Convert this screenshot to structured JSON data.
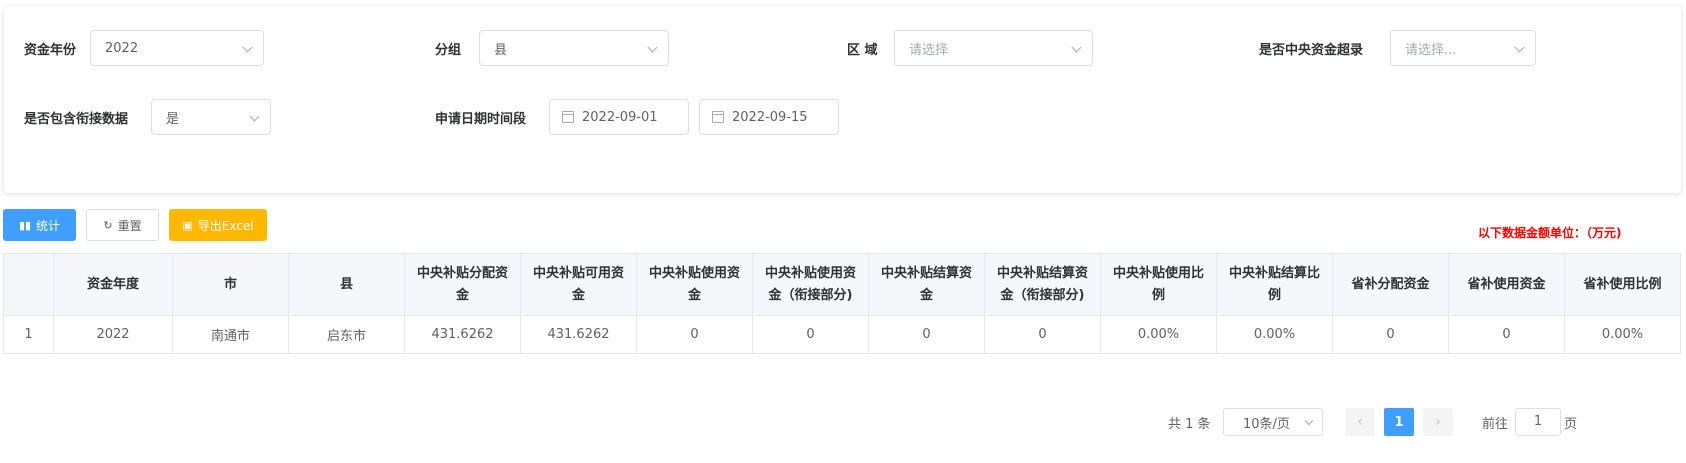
{
  "filters": {
    "fund_year": {
      "label": "资金年份",
      "value": "2022"
    },
    "group": {
      "label": "分组",
      "value": "县"
    },
    "region": {
      "label": "区 域",
      "placeholder": "请选择"
    },
    "central_over_record": {
      "label": "是否中央资金超录",
      "placeholder": "请选择..."
    },
    "include_link_data": {
      "label": "是否包含衔接数据",
      "value": "是"
    },
    "date_range": {
      "label": "申请日期时间段",
      "start": "2022-09-01",
      "end": "2022-09-15"
    }
  },
  "toolbar": {
    "stats_label": "统计",
    "reset_label": "重置",
    "export_label": "导出Excel",
    "unit_note": "以下数据金额单位：（万元)"
  },
  "table": {
    "headers": [
      "",
      "资金年度",
      "市",
      "县",
      "中央补贴分配资金",
      "中央补贴可用资金",
      "中央补贴使用资金",
      "中央补贴使用资金（衔接部分)",
      "中央补贴结算资金",
      "中央补贴结算资金（衔接部分)",
      "中央补贴使用比例",
      "中央补贴结算比例",
      "省补分配资金",
      "省补使用资金",
      "省补使用比例"
    ],
    "rows": [
      [
        "1",
        "2022",
        "南通市",
        "启东市",
        "431.6262",
        "431.6262",
        "0",
        "0",
        "0",
        "0",
        "0.00%",
        "0.00%",
        "0",
        "0",
        "0.00%"
      ]
    ]
  },
  "pagination": {
    "total": "共 1 条",
    "page_size": "10条/页",
    "current_page": "1",
    "goto_label": "前往",
    "goto_value": "1",
    "page_suffix": "页"
  },
  "colors": {
    "primary": "#409eff",
    "warning": "#ffb800",
    "note_red": "#ff0000"
  }
}
